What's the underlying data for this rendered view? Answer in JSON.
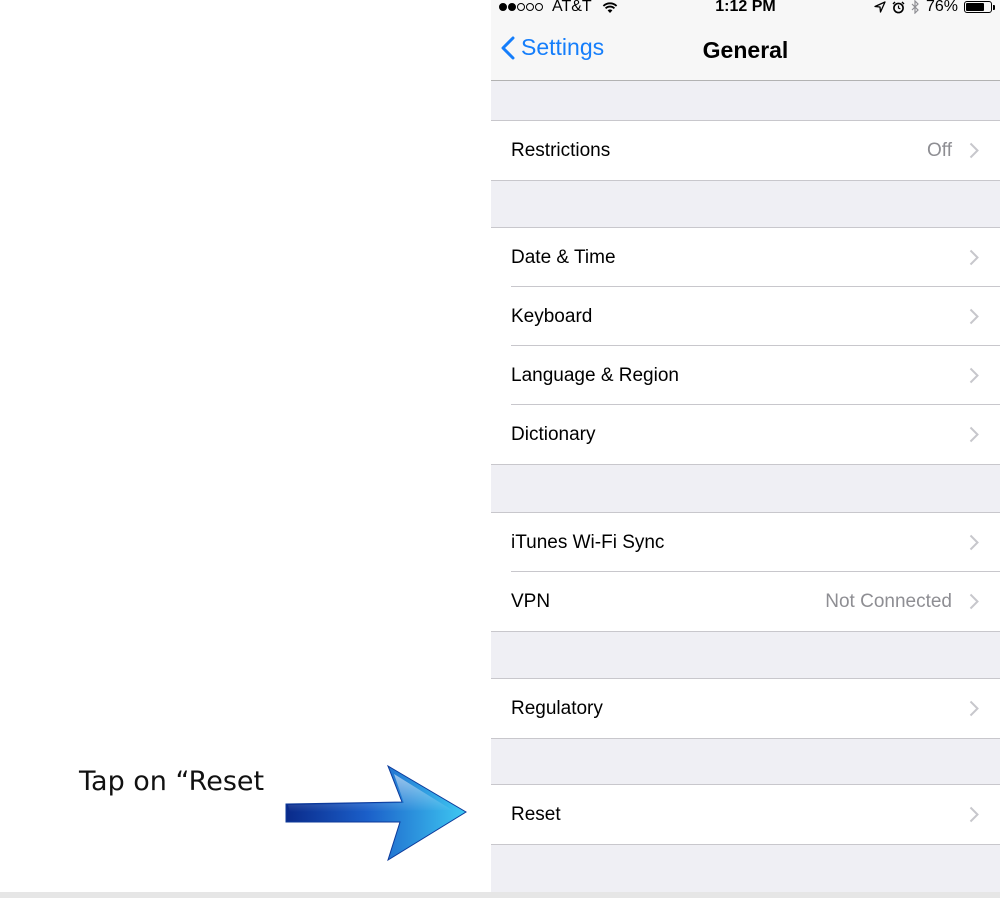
{
  "status_bar": {
    "carrier": "AT&T",
    "time": "1:12 PM",
    "battery": "76%",
    "battery_level": 0.76,
    "signal_bars_filled": 2,
    "signal_bars_total": 5
  },
  "nav": {
    "back_label": "Settings",
    "title": "General"
  },
  "groups": [
    {
      "rows": [
        {
          "label": "Restrictions",
          "value": "Off"
        }
      ]
    },
    {
      "rows": [
        {
          "label": "Date & Time",
          "value": ""
        },
        {
          "label": "Keyboard",
          "value": ""
        },
        {
          "label": "Language & Region",
          "value": ""
        },
        {
          "label": "Dictionary",
          "value": ""
        }
      ]
    },
    {
      "rows": [
        {
          "label": "iTunes Wi-Fi Sync",
          "value": ""
        },
        {
          "label": "VPN",
          "value": "Not Connected"
        }
      ]
    },
    {
      "rows": [
        {
          "label": "Regulatory",
          "value": ""
        }
      ]
    },
    {
      "rows": [
        {
          "label": "Reset",
          "value": ""
        }
      ]
    }
  ],
  "annotation": {
    "text": "Tap on “Reset"
  },
  "colors": {
    "accent": "#157efb",
    "background": "#efeff4",
    "secondary_text": "#8e8e93",
    "arrow_light": "#3ec9f2",
    "arrow_dark": "#0a2a8a"
  },
  "icons": [
    "back-chevron-icon",
    "wifi-icon",
    "location-icon",
    "alarm-icon",
    "bluetooth-icon",
    "battery-icon",
    "chevron-right-icon",
    "arrow-icon"
  ]
}
